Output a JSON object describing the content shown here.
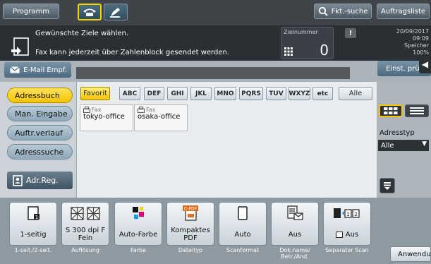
{
  "topbar": {
    "program_label": "Programm",
    "search_label": "Fkt.-suche",
    "jobs_label": "Auftragsliste"
  },
  "message": {
    "line1": "Gewünschte Ziele wählen.",
    "line2": "Fax kann jederzeit über Zahlenblock gesendet werden.",
    "zielnummer_label": "Zielnummer",
    "zielnummer_value": "0",
    "date": "20/09/2017",
    "time": "09:09",
    "memory_label": "Speicher",
    "memory_value": "100%"
  },
  "dest": {
    "email_label": "E-Mail Empf.",
    "einst_label": "Einst. prü"
  },
  "sidebar": {
    "items": [
      {
        "label": "Adressbuch"
      },
      {
        "label": "Man. Eingabe"
      },
      {
        "label": "Auftr.verlauf"
      },
      {
        "label": "Adresssuche"
      }
    ],
    "adr_reg_label": "Adr.Reg."
  },
  "index": {
    "favorite_label": "Favorit",
    "tabs": [
      "ABC",
      "DEF",
      "GHI",
      "JKL",
      "MNO",
      "PQRS",
      "TUV",
      "WXYZ",
      "etc"
    ],
    "all_label": "Alle"
  },
  "entries": [
    {
      "type": "Fax",
      "name": "tokyo-office"
    },
    {
      "type": "Fax",
      "name": "osaka-office"
    }
  ],
  "right": {
    "adresstyp_label": "Adresstyp",
    "adresstyp_value": "Alle"
  },
  "functions": [
    {
      "value": "1-seitig",
      "caption": "1-seit./2-seit."
    },
    {
      "value": "S 300 dpi F Fein",
      "caption": "Auflösung"
    },
    {
      "value": "Auto-Farbe",
      "caption": "Farbe"
    },
    {
      "value": "Kompaktes PDF",
      "caption": "Dateityp",
      "icon_text": "C-PDF"
    },
    {
      "value": "Auto",
      "caption": "Scanformat"
    },
    {
      "value": "Aus",
      "caption": "Dok.name/ Betr./And."
    },
    {
      "value": "Aus",
      "caption": "Separater Scan"
    }
  ],
  "application_label": "Anwendung",
  "colors": {
    "selected_yellow": "#f5c400",
    "topbar": "#3e4448",
    "message_bg": "#2a2f33"
  }
}
